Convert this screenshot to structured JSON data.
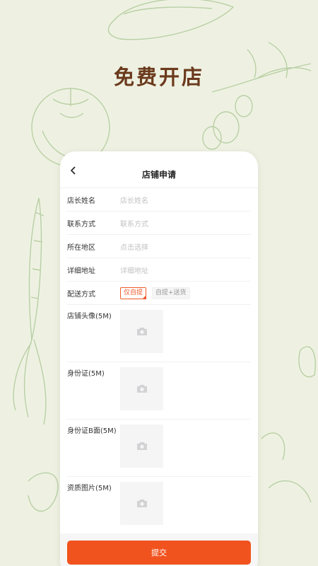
{
  "headline": "免费开店",
  "nav": {
    "title": "店铺申请",
    "back_icon": "chevron-left-icon"
  },
  "fields": [
    {
      "label": "店长姓名",
      "placeholder": "店长姓名"
    },
    {
      "label": "联系方式",
      "placeholder": "联系方式"
    },
    {
      "label": "所在地区",
      "placeholder": "点击选择"
    },
    {
      "label": "详细地址",
      "placeholder": "详细地址"
    }
  ],
  "delivery": {
    "label": "配送方式",
    "options": [
      {
        "label": "仅自提",
        "selected": true
      },
      {
        "label": "自提+送货",
        "selected": false
      }
    ]
  },
  "uploads": [
    {
      "label": "店铺头像(5M)"
    },
    {
      "label": "身份证(5M)"
    },
    {
      "label": "身份证B面(5M)"
    },
    {
      "label": "资质图片(5M)"
    }
  ],
  "upload_icon": "camera-icon",
  "submit_label": "提交",
  "colors": {
    "accent": "#f1531f",
    "headline": "#6b3a1d",
    "background": "#eef1e2"
  }
}
